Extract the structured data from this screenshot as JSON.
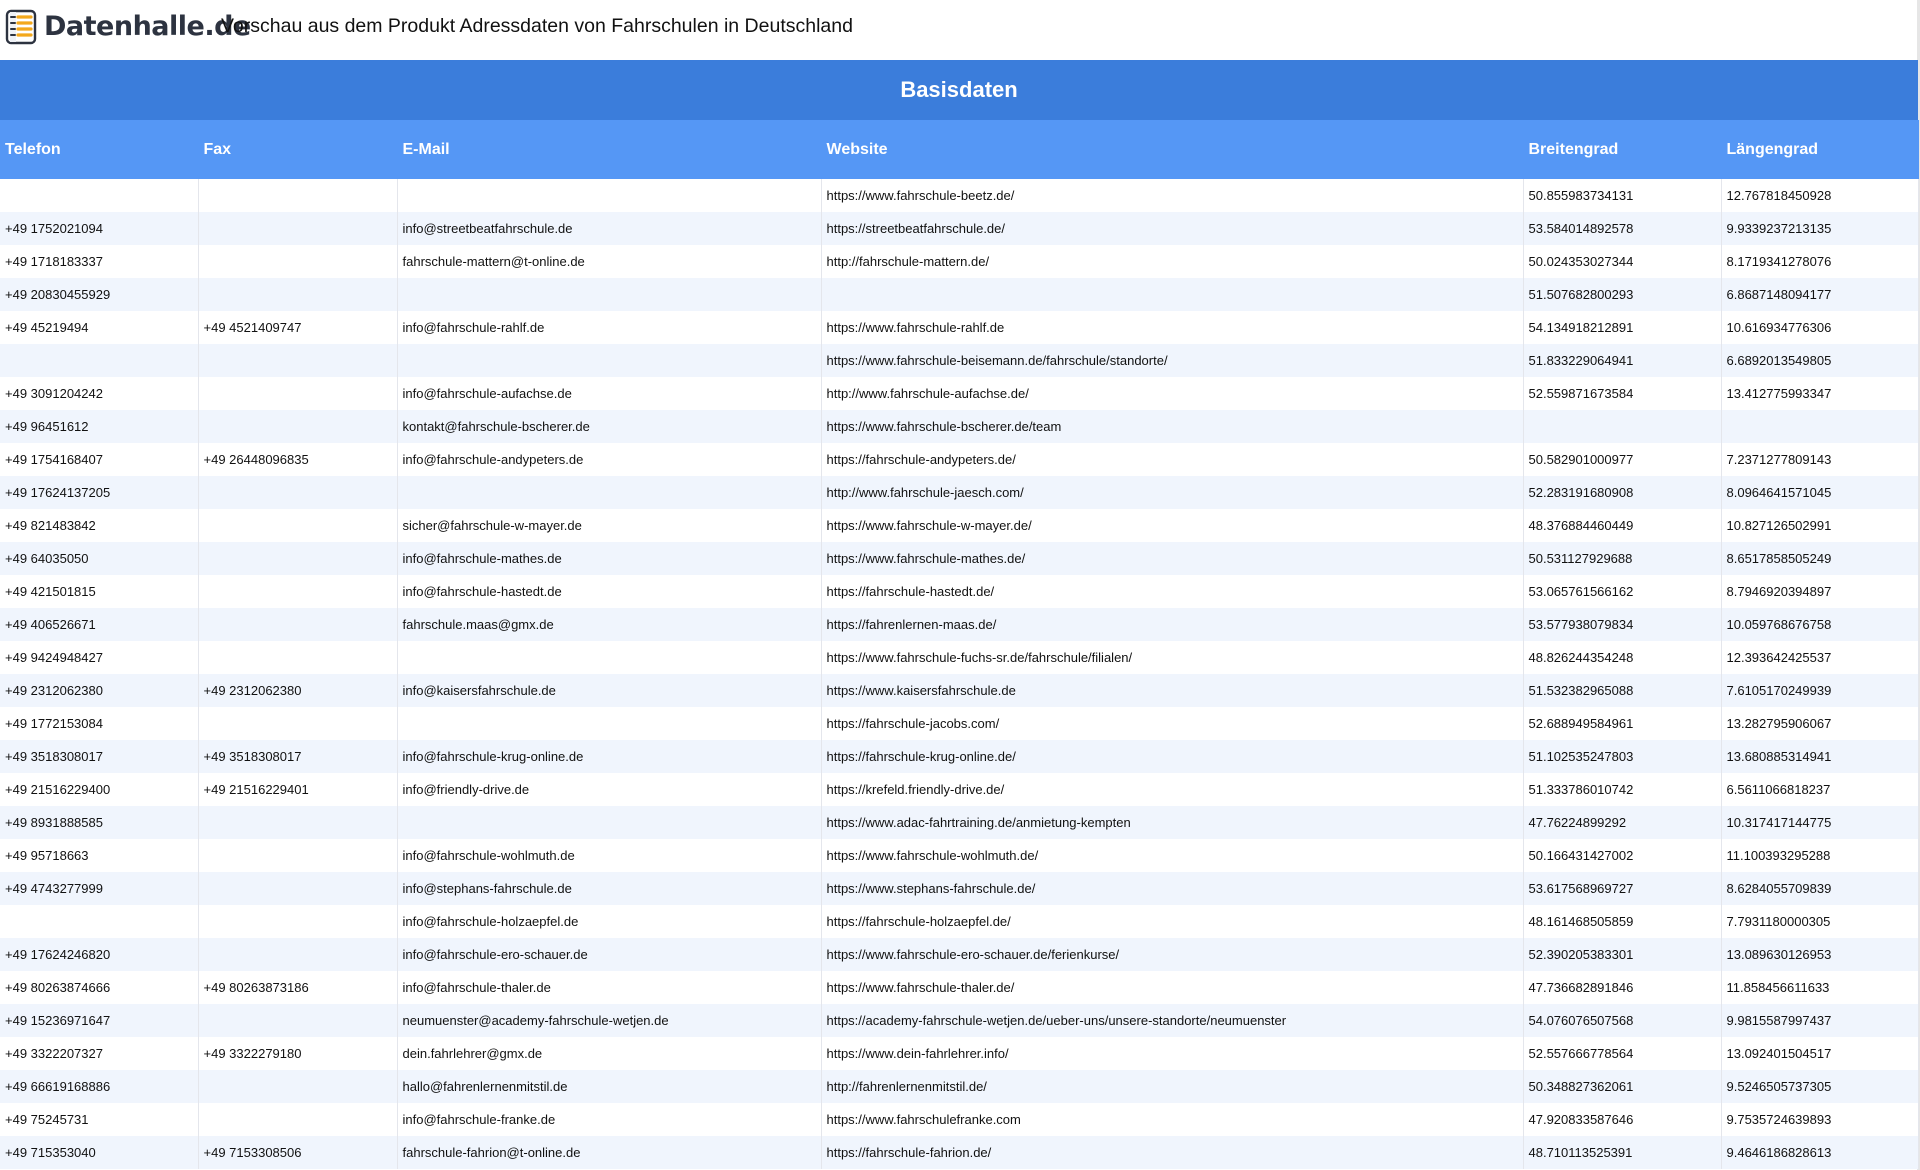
{
  "header": {
    "logo_text": "Datenhalle.de",
    "logo_icon": "database-stack-icon",
    "subtitle": "Vorschau aus dem Produkt Adressdaten von Fahrschulen in Deutschland"
  },
  "colors": {
    "group_header_bg": "#3b7ddb",
    "column_header_bg": "#5597f5",
    "row_alt_bg": "#f0f5fd"
  },
  "table": {
    "group_title": "Basisdaten",
    "columns": [
      "Telefon",
      "Fax",
      "E-Mail",
      "Website",
      "Breitengrad",
      "Längengrad"
    ],
    "rows": [
      [
        "",
        "",
        "",
        "https://www.fahrschule-beetz.de/",
        "50.855983734131",
        "12.767818450928"
      ],
      [
        "+49 1752021094",
        "",
        "info@streetbeatfahrschule.de",
        "https://streetbeatfahrschule.de/",
        "53.584014892578",
        "9.9339237213135"
      ],
      [
        "+49 1718183337",
        "",
        "fahrschule-mattern@t-online.de",
        "http://fahrschule-mattern.de/",
        "50.024353027344",
        "8.1719341278076"
      ],
      [
        "+49 20830455929",
        "",
        "",
        "",
        "51.507682800293",
        "6.8687148094177"
      ],
      [
        "+49 45219494",
        "+49 4521409747",
        "info@fahrschule-rahlf.de",
        "https://www.fahrschule-rahlf.de",
        "54.134918212891",
        "10.616934776306"
      ],
      [
        "",
        "",
        "",
        "https://www.fahrschule-beisemann.de/fahrschule/standorte/",
        "51.833229064941",
        "6.6892013549805"
      ],
      [
        "+49 3091204242",
        "",
        "info@fahrschule-aufachse.de",
        "http://www.fahrschule-aufachse.de/",
        "52.559871673584",
        "13.412775993347"
      ],
      [
        "+49 96451612",
        "",
        "kontakt@fahrschule-bscherer.de",
        "https://www.fahrschule-bscherer.de/team",
        "",
        ""
      ],
      [
        "+49 1754168407",
        "+49 26448096835",
        "info@fahrschule-andypeters.de",
        "https://fahrschule-andypeters.de/",
        "50.582901000977",
        "7.2371277809143"
      ],
      [
        "+49 17624137205",
        "",
        "",
        "http://www.fahrschule-jaesch.com/",
        "52.283191680908",
        "8.0964641571045"
      ],
      [
        "+49 821483842",
        "",
        "sicher@fahrschule-w-mayer.de",
        "https://www.fahrschule-w-mayer.de/",
        "48.376884460449",
        "10.827126502991"
      ],
      [
        "+49 64035050",
        "",
        "info@fahrschule-mathes.de",
        "https://www.fahrschule-mathes.de/",
        "50.531127929688",
        "8.6517858505249"
      ],
      [
        "+49 421501815",
        "",
        "info@fahrschule-hastedt.de",
        "https://fahrschule-hastedt.de/",
        "53.065761566162",
        "8.7946920394897"
      ],
      [
        "+49 406526671",
        "",
        "fahrschule.maas@gmx.de",
        "https://fahrenlernen-maas.de/",
        "53.577938079834",
        "10.059768676758"
      ],
      [
        "+49 9424948427",
        "",
        "",
        "https://www.fahrschule-fuchs-sr.de/fahrschule/filialen/",
        "48.826244354248",
        "12.393642425537"
      ],
      [
        "+49 2312062380",
        "+49 2312062380",
        "info@kaisersfahrschule.de",
        "https://www.kaisersfahrschule.de",
        "51.532382965088",
        "7.6105170249939"
      ],
      [
        "+49 1772153084",
        "",
        "",
        "https://fahrschule-jacobs.com/",
        "52.688949584961",
        "13.282795906067"
      ],
      [
        "+49 3518308017",
        "+49 3518308017",
        "info@fahrschule-krug-online.de",
        "https://fahrschule-krug-online.de/",
        "51.102535247803",
        "13.680885314941"
      ],
      [
        "+49 21516229400",
        "+49 21516229401",
        "info@friendly-drive.de",
        "https://krefeld.friendly-drive.de/",
        "51.333786010742",
        "6.5611066818237"
      ],
      [
        "+49 8931888585",
        "",
        "",
        "https://www.adac-fahrtraining.de/anmietung-kempten",
        "47.76224899292",
        "10.317417144775"
      ],
      [
        "+49 95718663",
        "",
        "info@fahrschule-wohlmuth.de",
        "https://www.fahrschule-wohlmuth.de/",
        "50.166431427002",
        "11.100393295288"
      ],
      [
        "+49 4743277999",
        "",
        "info@stephans-fahrschule.de",
        "https://www.stephans-fahrschule.de/",
        "53.617568969727",
        "8.6284055709839"
      ],
      [
        "",
        "",
        "info@fahrschule-holzaepfel.de",
        "https://fahrschule-holzaepfel.de/",
        "48.161468505859",
        "7.7931180000305"
      ],
      [
        "+49 17624246820",
        "",
        "info@fahrschule-ero-schauer.de",
        "https://www.fahrschule-ero-schauer.de/ferienkurse/",
        "52.390205383301",
        "13.089630126953"
      ],
      [
        "+49 80263874666",
        "+49 80263873186",
        "info@fahrschule-thaler.de",
        "https://www.fahrschule-thaler.de/",
        "47.736682891846",
        "11.858456611633"
      ],
      [
        "+49 15236971647",
        "",
        "neumuenster@academy-fahrschule-wetjen.de",
        "https://academy-fahrschule-wetjen.de/ueber-uns/unsere-standorte/neumuenster",
        "54.076076507568",
        "9.9815587997437"
      ],
      [
        "+49 3322207327",
        "+49 3322279180",
        "dein.fahrlehrer@gmx.de",
        "https://www.dein-fahrlehrer.info/",
        "52.557666778564",
        "13.092401504517"
      ],
      [
        "+49 66619168886",
        "",
        "hallo@fahrenlernenmitstil.de",
        "http://fahrenlernenmitstil.de/",
        "50.348827362061",
        "9.5246505737305"
      ],
      [
        "+49 75245731",
        "",
        "info@fahrschule-franke.de",
        "https://www.fahrschulefranke.com",
        "47.920833587646",
        "9.7535724639893"
      ],
      [
        "+49 715353040",
        "+49 7153308506",
        "fahrschule-fahrion@t-online.de",
        "https://fahrschule-fahrion.de/",
        "48.710113525391",
        "9.4646186828613"
      ]
    ]
  }
}
